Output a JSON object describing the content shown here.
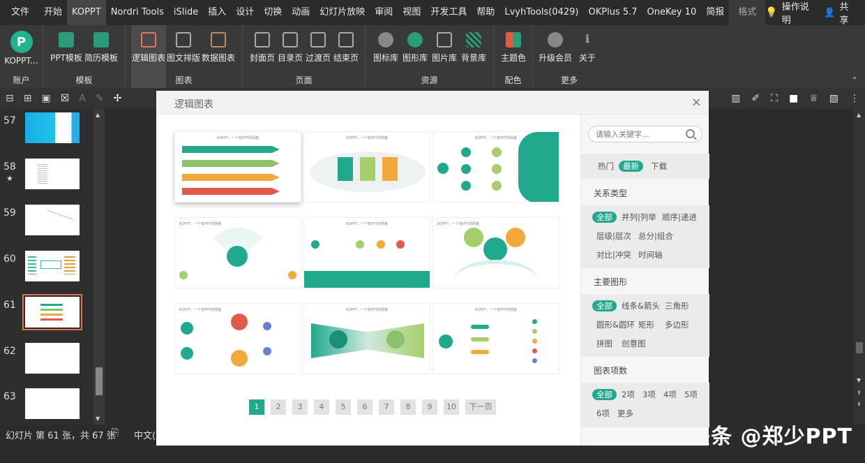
{
  "menu": {
    "tabs": [
      "文件",
      "开始",
      "KOPPT",
      "Nordri Tools",
      "iSlide",
      "插入",
      "设计",
      "切换",
      "动画",
      "幻灯片放映",
      "审阅",
      "视图",
      "开发工具",
      "帮助",
      "LvyhTools(0429)",
      "OKPlus 5.7",
      "OneKey 10",
      "简报",
      "格式"
    ],
    "active": "KOPPT",
    "help": "操作说明",
    "share": "共享"
  },
  "ribbon": {
    "groups": [
      {
        "label": "账户",
        "buttons": [
          "KOPPT..."
        ]
      },
      {
        "label": "模板",
        "buttons": [
          "PPT模板",
          "简历模板"
        ]
      },
      {
        "label": "图表",
        "buttons": [
          "逻辑图表",
          "图文排版",
          "数据图表"
        ]
      },
      {
        "label": "页面",
        "buttons": [
          "封面页",
          "目录页",
          "过渡页",
          "结束页"
        ]
      },
      {
        "label": "资源",
        "buttons": [
          "图标库",
          "图形库",
          "图片库",
          "背景库"
        ]
      },
      {
        "label": "配色",
        "buttons": [
          "主题色"
        ]
      },
      {
        "label": "更多",
        "buttons": [
          "升级会员",
          "关于"
        ]
      }
    ],
    "logo_letter": "P",
    "logo_color": "#21b28e"
  },
  "slides": [
    {
      "num": "57",
      "star": ""
    },
    {
      "num": "58",
      "star": "★"
    },
    {
      "num": "59",
      "star": ""
    },
    {
      "num": "60",
      "star": ""
    },
    {
      "num": "61",
      "star": ""
    },
    {
      "num": "62",
      "star": ""
    },
    {
      "num": "63",
      "star": ""
    }
  ],
  "status": {
    "text": "幻灯片 第 61 张，共 67 张",
    "lang": "中文(中"
  },
  "watermark": "头条 @郑少PPT",
  "dialog": {
    "title": "逻辑图表",
    "close": "×",
    "card_title": "KOPPT，一个有PPT的网盘",
    "pages": [
      "1",
      "2",
      "3",
      "4",
      "5",
      "6",
      "7",
      "8",
      "9",
      "10"
    ],
    "active_page": "1",
    "next": "下一页",
    "accent": "#21a98d",
    "sidebar": {
      "search_placeholder": "请输入关键字...",
      "sort": [
        "热门",
        "最新",
        "下载"
      ],
      "sort_active": "最新",
      "relation_title": "关系类型",
      "relations": [
        "全部",
        "并列|列举",
        "顺序|递进",
        "层级|层次",
        "总分|组合",
        "对比|冲突",
        "时间轴"
      ],
      "shape_title": "主要图形",
      "shapes": [
        "全部",
        "线条&箭头",
        "三角形",
        "圆形&圆环",
        "矩形",
        "多边形",
        "拼图",
        "创意图"
      ],
      "count_title": "图表项数",
      "counts": [
        "全部",
        "2项",
        "3项",
        "4项",
        "5项",
        "6项",
        "更多"
      ]
    }
  }
}
